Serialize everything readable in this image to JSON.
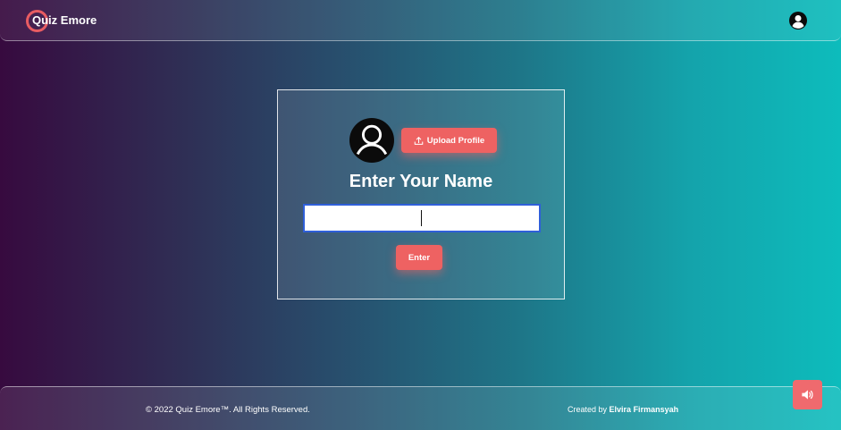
{
  "header": {
    "brand": "Quiz Emore",
    "accent_color": "#e85c62",
    "user_icon": "user-circle-icon"
  },
  "card": {
    "avatar_icon": "user-circle-icon",
    "upload_icon": "upload-icon",
    "upload_label": "Upload Profile",
    "title": "Enter Your Name",
    "name_input": {
      "value": "",
      "placeholder": ""
    },
    "enter_label": "Enter",
    "button_color": "#ee6262"
  },
  "footer": {
    "copyright": "© 2022 Quiz Emore™. All Rights Reserved.",
    "credit_prefix": "Created by",
    "credit_name": "Elvira Firmansyah"
  },
  "sound_button": {
    "icon": "volume-icon"
  }
}
